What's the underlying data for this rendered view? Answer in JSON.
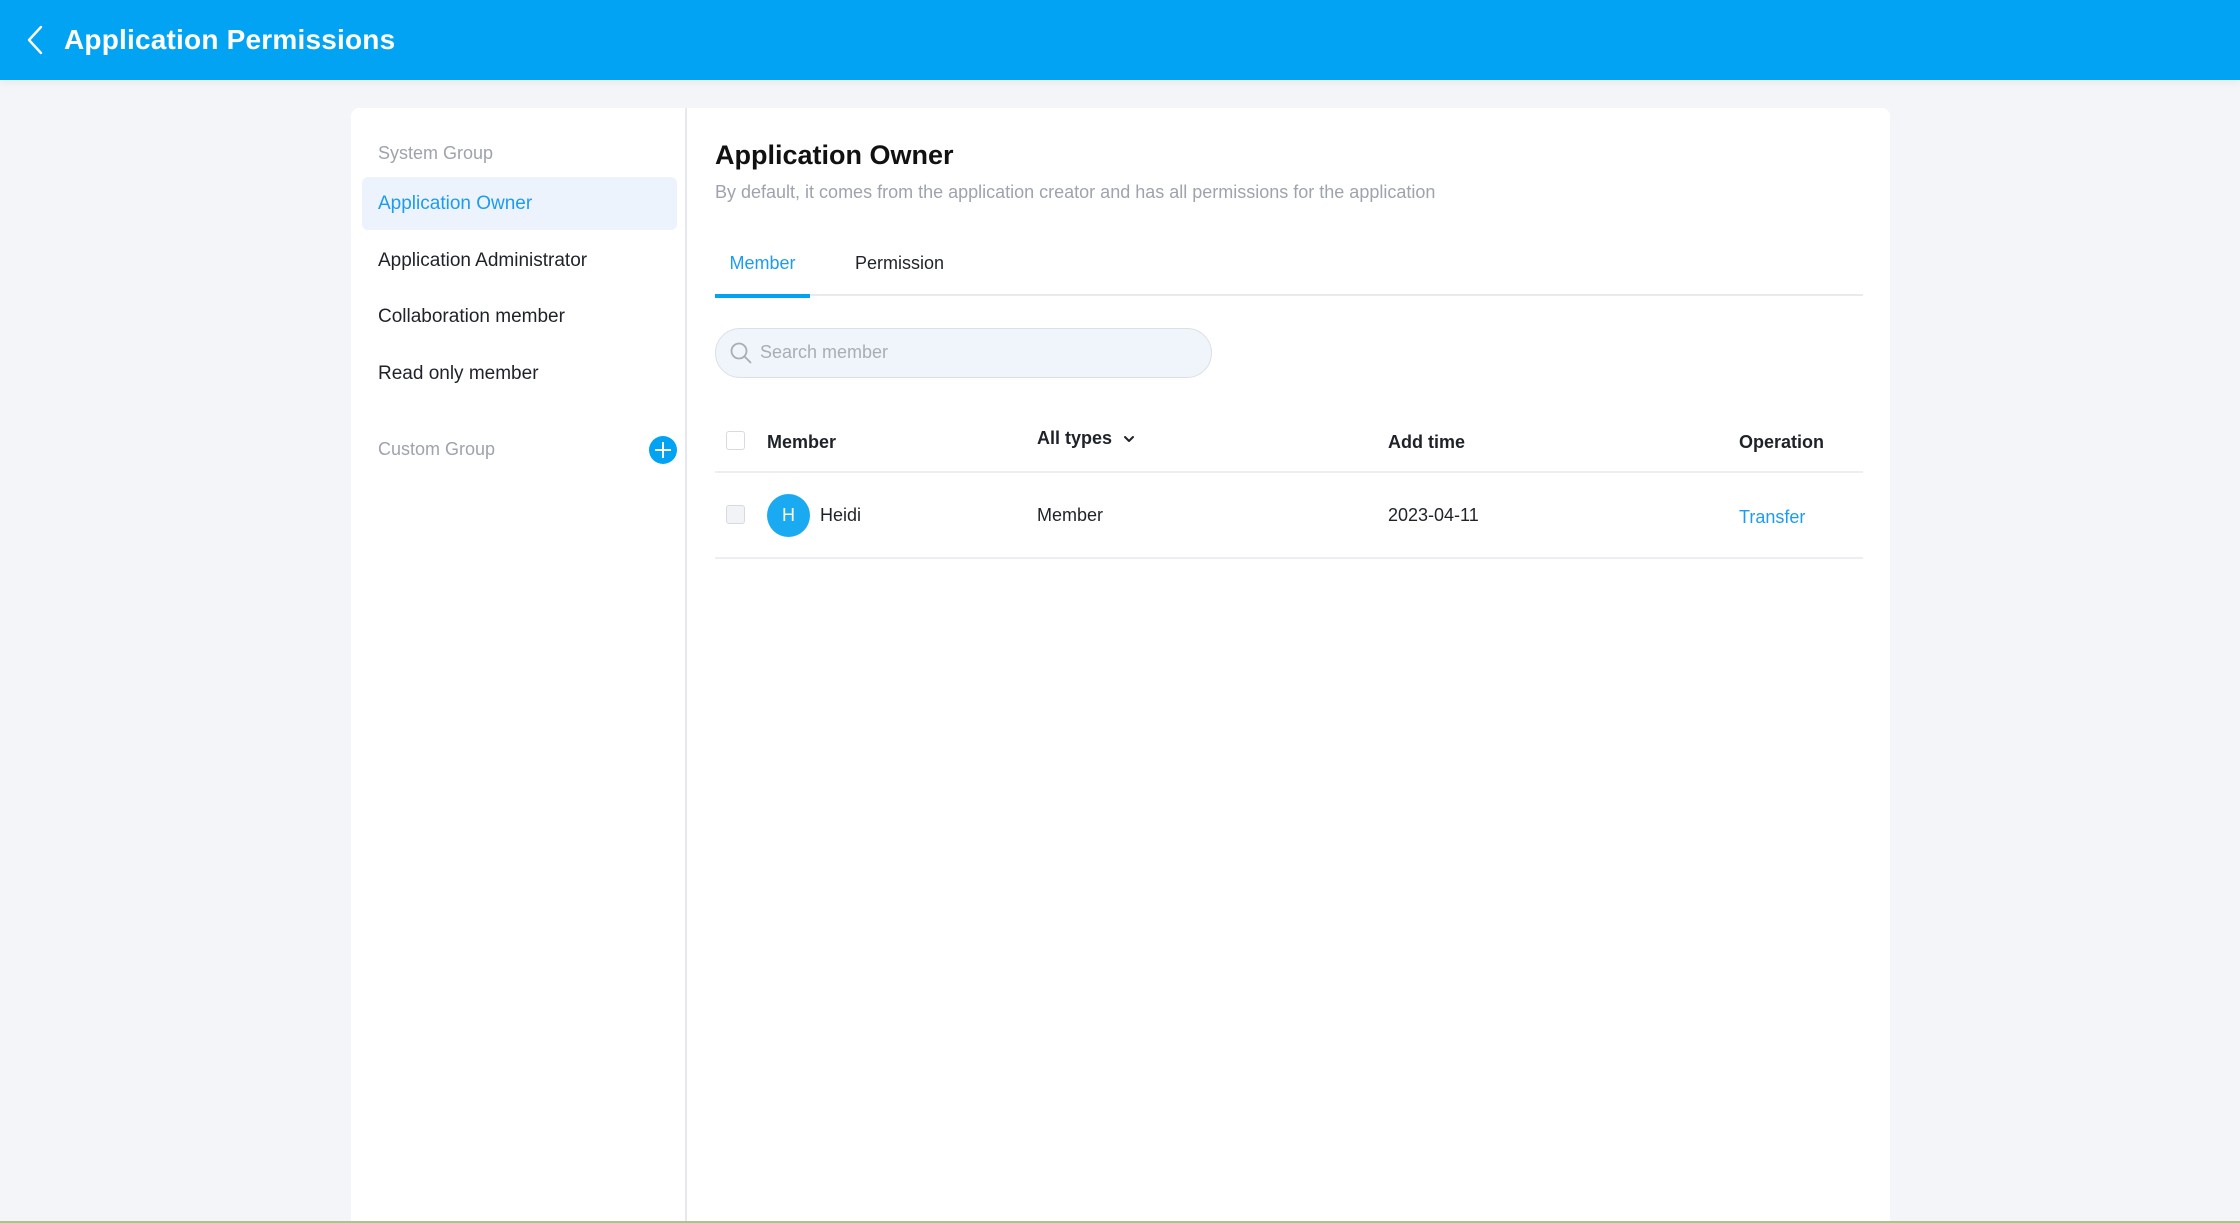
{
  "header": {
    "title": "Application Permissions",
    "back_icon": "chevron-left-icon",
    "color": "#03a3f3"
  },
  "sidebar": {
    "system_group_label": "System Group",
    "items": [
      {
        "label": "Application Owner",
        "active": true
      },
      {
        "label": "Application Administrator",
        "active": false
      },
      {
        "label": "Collaboration member",
        "active": false
      },
      {
        "label": "Read only member",
        "active": false
      }
    ],
    "custom_group_label": "Custom Group",
    "add_icon": "plus-circle-icon"
  },
  "main": {
    "title": "Application Owner",
    "description": "By default, it comes from the application creator and has all permissions for the application",
    "tabs": [
      {
        "label": "Member",
        "active": true
      },
      {
        "label": "Permission",
        "active": false
      }
    ],
    "search": {
      "placeholder": "Search member",
      "value": ""
    },
    "table": {
      "columns": {
        "member": "Member",
        "type": "All types",
        "add_time": "Add time",
        "operation": "Operation"
      },
      "rows": [
        {
          "avatar_initial": "H",
          "name": "Heidi",
          "type": "Member",
          "add_time": "2023-04-11",
          "operation": "Transfer"
        }
      ]
    }
  },
  "accent_color": "#1c9cf0"
}
